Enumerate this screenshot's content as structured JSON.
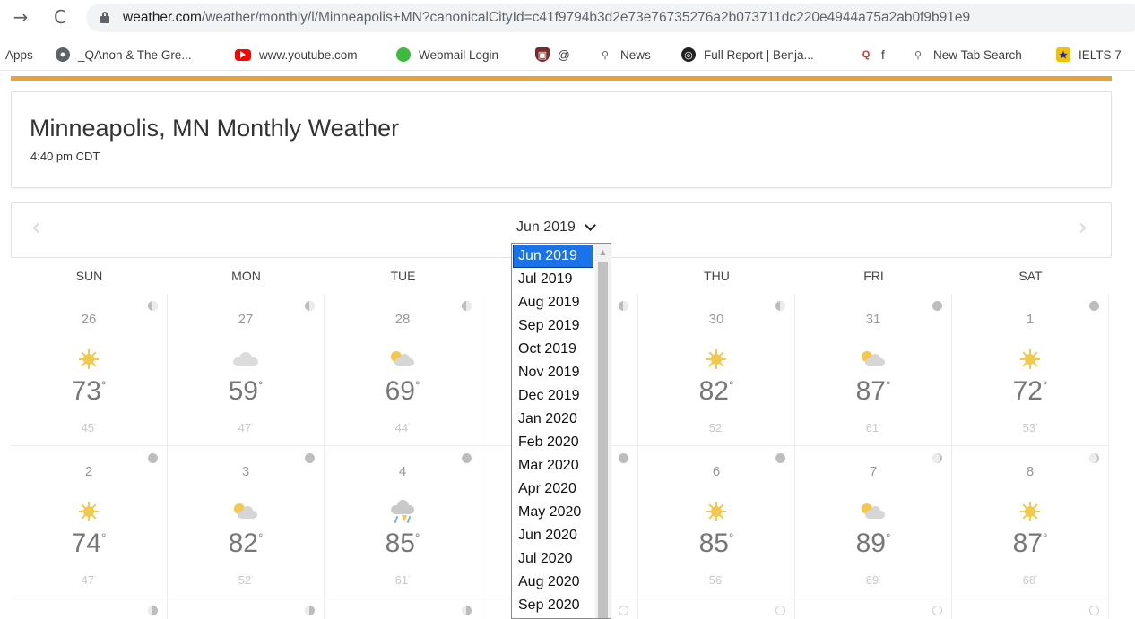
{
  "browser": {
    "back_icon": "→",
    "reload_icon": "C",
    "url_host": "weather.com",
    "url_path": "/weather/monthly/l/Minneapolis+MN?canonicalCityId=c41f9794b3d2e73e76735276a2b073711dc220e4944a75a2ab0f9b91e9",
    "bookmarks": [
      {
        "label": "Apps",
        "icon": "apps"
      },
      {
        "label": "_QAnon & The Gre...",
        "icon": "globe-icon"
      },
      {
        "label": "www.youtube.com",
        "icon": "youtube-icon"
      },
      {
        "label": "Webmail Login",
        "icon": "green-dot-icon"
      },
      {
        "label": "@",
        "icon": "shield-icon"
      },
      {
        "label": "News",
        "icon": "search-icon"
      },
      {
        "label": "Full Report | Benja...",
        "icon": "swirl-icon"
      },
      {
        "label": "f",
        "icon": "q-icon"
      },
      {
        "label": "New Tab Search",
        "icon": "search-icon"
      },
      {
        "label": "IELTS 7",
        "icon": "ielts-icon"
      }
    ]
  },
  "header": {
    "title": "Minneapolis, MN Monthly Weather",
    "time": "4:40 pm CDT"
  },
  "month_nav": {
    "current": "Jun 2019",
    "prev_icon": "‹",
    "next_icon": "›"
  },
  "days_of_week": [
    "SUN",
    "MON",
    "TUE",
    "WED",
    "THU",
    "FRI",
    "SAT"
  ],
  "weeks": [
    [
      {
        "date": "26",
        "icon": "sun",
        "hi": "73",
        "lo": "45",
        "moon": "half-l"
      },
      {
        "date": "27",
        "icon": "cloud",
        "hi": "59",
        "lo": "47",
        "moon": "half-l"
      },
      {
        "date": "28",
        "icon": "partly-cloudy",
        "hi": "69",
        "lo": "44",
        "moon": "half-l"
      },
      {
        "date": "",
        "icon": "",
        "hi": "",
        "lo": "",
        "moon": "half-l"
      },
      {
        "date": "30",
        "icon": "sun",
        "hi": "82",
        "lo": "52",
        "moon": "half-l"
      },
      {
        "date": "31",
        "icon": "partly-cloudy",
        "hi": "87",
        "lo": "61",
        "moon": "full"
      },
      {
        "date": "1",
        "icon": "sun",
        "hi": "72",
        "lo": "53",
        "moon": "full"
      }
    ],
    [
      {
        "date": "2",
        "icon": "sun",
        "hi": "74",
        "lo": "47",
        "moon": "full"
      },
      {
        "date": "3",
        "icon": "partly-cloudy",
        "hi": "82",
        "lo": "52",
        "moon": "full"
      },
      {
        "date": "4",
        "icon": "storm",
        "hi": "85",
        "lo": "61",
        "moon": "full"
      },
      {
        "date": "",
        "icon": "",
        "hi": "",
        "lo": "",
        "moon": "full"
      },
      {
        "date": "6",
        "icon": "sun",
        "hi": "85",
        "lo": "56",
        "moon": "full"
      },
      {
        "date": "7",
        "icon": "partly-cloudy",
        "hi": "89",
        "lo": "69",
        "moon": "thin"
      },
      {
        "date": "8",
        "icon": "sun",
        "hi": "87",
        "lo": "68",
        "moon": "thin"
      }
    ]
  ],
  "third_row_moons": [
    "half-r",
    "half-r",
    "half-r",
    "empty",
    "empty",
    "empty",
    "empty"
  ],
  "dropdown": {
    "options": [
      "Jun 2019",
      "Jul 2019",
      "Aug 2019",
      "Sep 2019",
      "Oct 2019",
      "Nov 2019",
      "Dec 2019",
      "Jan 2020",
      "Feb 2020",
      "Mar 2020",
      "Apr 2020",
      "May 2020",
      "Jun 2020",
      "Jul 2020",
      "Aug 2020",
      "Sep 2020"
    ],
    "selected": "Jun 2019"
  },
  "colors": {
    "accent": "#e9a23b",
    "selected": "#1a73e8",
    "sun": "#f2c94c"
  }
}
